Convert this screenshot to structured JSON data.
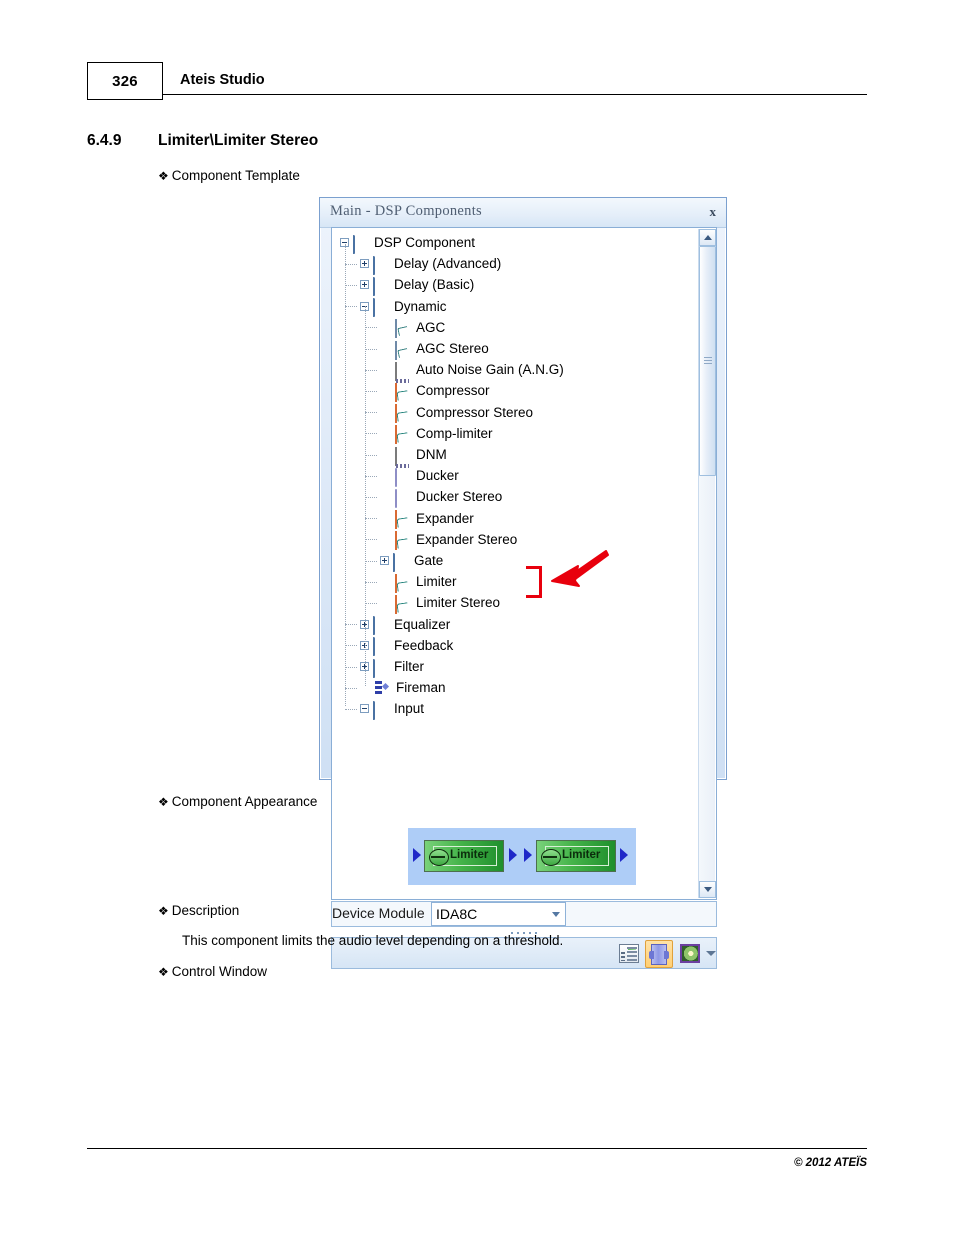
{
  "page": {
    "number": "326",
    "header_title": "Ateis Studio",
    "section_number": "6.4.9",
    "section_title": "Limiter\\Limiter Stereo",
    "footer": "© 2012 ATEÏS"
  },
  "bullets": {
    "glyph": "❖",
    "component_template": "Component Template",
    "component_appearance": "Component Appearance",
    "description": "Description",
    "control_window": "Control Window"
  },
  "description_text": "This component limits the audio level depending on a threshold.",
  "dialog": {
    "title": "Main - DSP Components",
    "close_label": "x",
    "device_module_label": "Device Module",
    "device_module_value": "IDA8C",
    "tree": [
      {
        "label": "DSP Component",
        "depth": 0,
        "icon": "folder-open",
        "toggle": "minus"
      },
      {
        "label": "Delay (Advanced)",
        "depth": 1,
        "icon": "folder-closed",
        "toggle": "plus"
      },
      {
        "label": "Delay (Basic)",
        "depth": 1,
        "icon": "folder-closed",
        "toggle": "plus"
      },
      {
        "label": "Dynamic",
        "depth": 1,
        "icon": "folder-open",
        "toggle": "minus"
      },
      {
        "label": "AGC",
        "depth": 2,
        "icon": "agc-curve",
        "toggle": "none"
      },
      {
        "label": "AGC Stereo",
        "depth": 2,
        "icon": "agc-curve",
        "toggle": "none"
      },
      {
        "label": "Auto Noise Gain (A.N.G)",
        "depth": 2,
        "icon": "ang-meter",
        "toggle": "none"
      },
      {
        "label": "Compressor",
        "depth": 2,
        "icon": "grid-curve",
        "toggle": "none"
      },
      {
        "label": "Compressor Stereo",
        "depth": 2,
        "icon": "grid-curve",
        "toggle": "none"
      },
      {
        "label": "Comp-limiter",
        "depth": 2,
        "icon": "grid-curve",
        "toggle": "none"
      },
      {
        "label": "DNM",
        "depth": 2,
        "icon": "ang-meter",
        "toggle": "none"
      },
      {
        "label": "Ducker",
        "depth": 2,
        "icon": "ducker",
        "toggle": "none"
      },
      {
        "label": "Ducker Stereo",
        "depth": 2,
        "icon": "ducker",
        "toggle": "none"
      },
      {
        "label": "Expander",
        "depth": 2,
        "icon": "grid-curve",
        "toggle": "none"
      },
      {
        "label": "Expander Stereo",
        "depth": 2,
        "icon": "grid-curve",
        "toggle": "none"
      },
      {
        "label": "Gate",
        "depth": 2,
        "icon": "folder-closed",
        "toggle": "plus"
      },
      {
        "label": "Limiter",
        "depth": 2,
        "icon": "grid-curve",
        "toggle": "none"
      },
      {
        "label": "Limiter Stereo",
        "depth": 2,
        "icon": "grid-curve",
        "toggle": "none"
      },
      {
        "label": "Equalizer",
        "depth": 1,
        "icon": "folder-closed",
        "toggle": "plus"
      },
      {
        "label": "Feedback",
        "depth": 1,
        "icon": "folder-closed",
        "toggle": "plus"
      },
      {
        "label": "Filter",
        "depth": 1,
        "icon": "folder-closed",
        "toggle": "plus"
      },
      {
        "label": "Fireman",
        "depth": 1,
        "icon": "fireman",
        "toggle": "none"
      },
      {
        "label": "Input",
        "depth": 1,
        "icon": "folder-open",
        "toggle": "minus"
      }
    ],
    "toolbar": {
      "details_view_label": "Details view",
      "panel_view_label": "Panel view",
      "picture_view_label": "Picture view",
      "overflow_label": "More"
    }
  },
  "appearance": {
    "block_label_1": "Limiter",
    "block_label_2": "Limiter"
  },
  "annotation": {
    "color": "#e8000d"
  },
  "colors": {
    "dialog_border": "#7ba0cf",
    "titlebar_text": "#4f5e72",
    "selection_highlight": "#ffcf73",
    "appearance_background": "#aecdf7",
    "block_green": "#45b44a",
    "port_blue": "#1f28c8"
  }
}
